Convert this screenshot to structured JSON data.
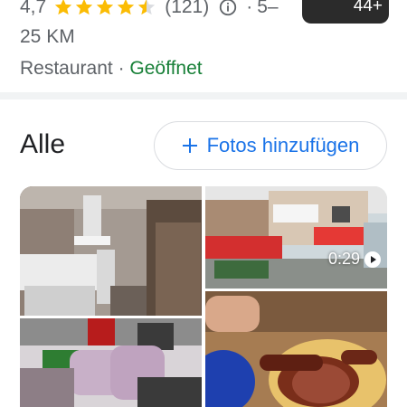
{
  "header": {
    "rating": "4,7",
    "stars": 4.5,
    "review_count": "(121)",
    "distance_prefix": "5–",
    "distance_suffix": "25 KM",
    "category": "Restaurant",
    "separator": "·",
    "status": "Geöffnet",
    "photo_count_badge": "44+"
  },
  "section": {
    "title": "Alle",
    "add_photos_label": "Fotos hinzufügen"
  },
  "photos": [
    {
      "kind": "image",
      "subject": "restaurant-interior"
    },
    {
      "kind": "video",
      "subject": "building-exterior",
      "duration": "0:29"
    },
    {
      "kind": "image",
      "subject": "terrace-chairs"
    },
    {
      "kind": "image",
      "subject": "grilled-meat-plate"
    }
  ],
  "colors": {
    "star": "#fbbc04",
    "link_blue": "#1a73e8",
    "open_green": "#188038",
    "muted_text": "#5f6368"
  }
}
